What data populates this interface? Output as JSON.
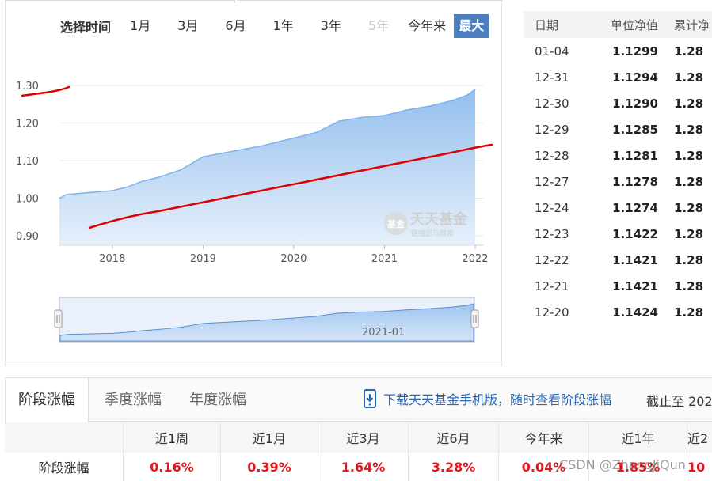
{
  "time_selector": {
    "label": "选择时间",
    "options": [
      {
        "label": "1月",
        "state": "normal"
      },
      {
        "label": "3月",
        "state": "normal"
      },
      {
        "label": "6月",
        "state": "normal"
      },
      {
        "label": "1年",
        "state": "normal"
      },
      {
        "label": "3年",
        "state": "normal"
      },
      {
        "label": "5年",
        "state": "disabled"
      },
      {
        "label": "今年来",
        "state": "normal"
      },
      {
        "label": "最大",
        "state": "active"
      }
    ]
  },
  "chart": {
    "y_ticks": [
      "1.30",
      "1.20",
      "1.10",
      "1.00",
      "0.90"
    ],
    "x_ticks": [
      "2018",
      "2019",
      "2020",
      "2021",
      "2022"
    ],
    "navigator_label": "2021-01",
    "watermark_brand": "天天基金",
    "watermark_sub": "链接您与财富",
    "watermark_badge": "基金",
    "colors": {
      "area_fill": "#a9cbf2",
      "area_line": "#7fb2ea",
      "annotation": "#e00000"
    }
  },
  "chart_data": {
    "type": "area",
    "x": [
      "2017-06",
      "2017-07",
      "2017-10",
      "2018-01",
      "2018-03",
      "2018-05",
      "2018-07",
      "2018-10",
      "2019-01",
      "2019-05",
      "2019-09",
      "2020-01",
      "2020-04",
      "2020-07",
      "2020-10",
      "2021-01",
      "2021-04",
      "2021-07",
      "2021-10",
      "2021-12",
      "2022-01"
    ],
    "series": [
      {
        "values": [
          1.0,
          1.01,
          1.015,
          1.02,
          1.03,
          1.045,
          1.055,
          1.075,
          1.11,
          1.125,
          1.14,
          1.16,
          1.175,
          1.205,
          1.215,
          1.22,
          1.235,
          1.245,
          1.26,
          1.275,
          1.29
        ]
      }
    ],
    "ylim": [
      0.9,
      1.3
    ],
    "ytick_labels": [
      "1.30",
      "1.20",
      "1.10",
      "1.00",
      "0.90"
    ],
    "xtick_labels": [
      "2018",
      "2019",
      "2020",
      "2021",
      "2022"
    ],
    "grid": true
  },
  "nav_table": {
    "headers": [
      "日期",
      "单位净值",
      "累计净"
    ],
    "rows": [
      [
        "01-04",
        "1.1299",
        "1.28"
      ],
      [
        "12-31",
        "1.1294",
        "1.28"
      ],
      [
        "12-30",
        "1.1290",
        "1.28"
      ],
      [
        "12-29",
        "1.1285",
        "1.28"
      ],
      [
        "12-28",
        "1.1281",
        "1.28"
      ],
      [
        "12-27",
        "1.1278",
        "1.28"
      ],
      [
        "12-24",
        "1.1274",
        "1.28"
      ],
      [
        "12-23",
        "1.1422",
        "1.28"
      ],
      [
        "12-22",
        "1.1421",
        "1.28"
      ],
      [
        "12-21",
        "1.1421",
        "1.28"
      ],
      [
        "12-20",
        "1.1424",
        "1.28"
      ]
    ]
  },
  "perf_tabs": {
    "tabs": [
      "阶段涨幅",
      "季度涨幅",
      "年度涨幅"
    ],
    "download_text": "下载天天基金手机版，随时查看阶段涨幅",
    "deadline_text": "截止至 202"
  },
  "perf_table": {
    "headers": [
      "",
      "近1周",
      "近1月",
      "近3月",
      "近6月",
      "今年来",
      "近1年",
      "近2"
    ],
    "row_label": "阶段涨幅",
    "values": [
      "0.16%",
      "0.39%",
      "1.64%",
      "3.28%",
      "0.04%",
      "1.85%",
      "10"
    ]
  },
  "watermark": "CSDN @ZhangJiQun"
}
